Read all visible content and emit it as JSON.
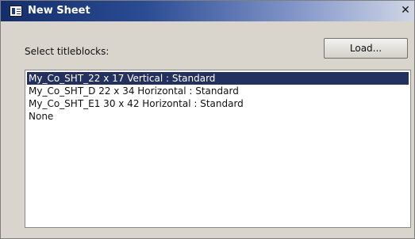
{
  "window": {
    "title": "New Sheet",
    "close_glyph": "✕"
  },
  "icons": {
    "app": "sheet-icon",
    "close": "close-icon"
  },
  "dialog": {
    "label": "Select titleblocks:",
    "load_label": "Load..."
  },
  "titleblocks": {
    "items": [
      "My_Co_SHT_22 x 17 Vertical : Standard",
      "My_Co_SHT_D 22 x 34 Horizontal : Standard",
      "My_Co_SHT_E1 30 x 42 Horizontal : Standard",
      "None"
    ],
    "selected_index": 0
  },
  "colors": {
    "selection": "#24305e",
    "titlebar_dark": "#142d6c",
    "dialog_bg": "#d9d5cd"
  }
}
